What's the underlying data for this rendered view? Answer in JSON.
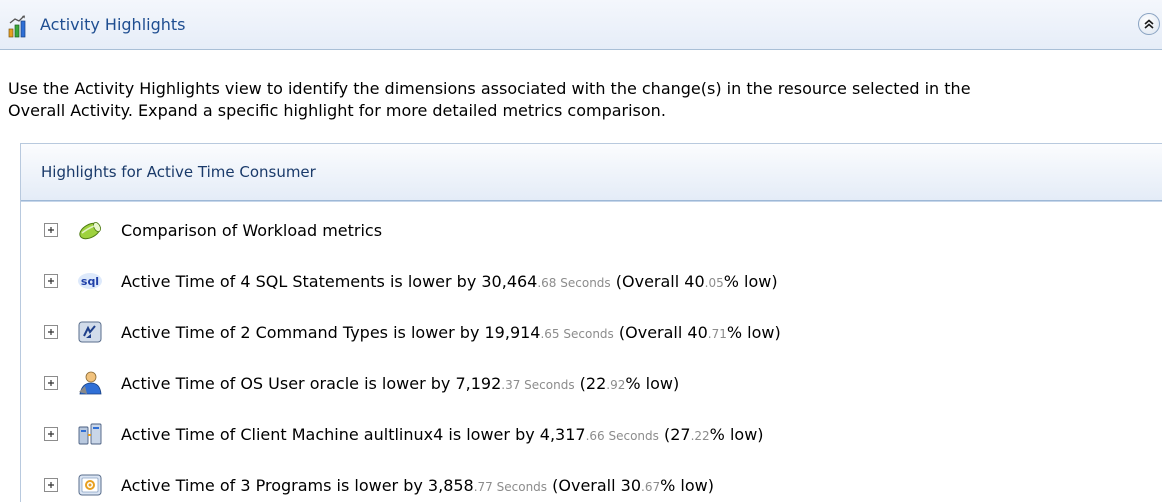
{
  "header": {
    "title": "Activity Highlights",
    "icon": "activity-chart-icon",
    "collapse_icon": "double-chevron-up-icon"
  },
  "intro": {
    "line1": "Use the Activity Highlights view to identify the dimensions associated with the change(s) in the resource selected in the",
    "line2": "Overall Activity. Expand a specific highlight for more detailed metrics comparison."
  },
  "highlights": {
    "title": "Highlights for Active Time Consumer",
    "rows": [
      {
        "icon": "workload-capsule-icon",
        "text": "Comparison of Workload metrics"
      },
      {
        "icon": "sql-icon",
        "prefix": "Active Time of 4 SQL Statements is lower by 30,464",
        "decimals": ".68 Seconds",
        "mid": " (Overall 40",
        "pct_decimals": ".05",
        "suffix": "% low)"
      },
      {
        "icon": "command-types-icon",
        "prefix": "Active Time of 2 Command Types is lower by 19,914",
        "decimals": ".65 Seconds",
        "mid": " (Overall 40",
        "pct_decimals": ".71",
        "suffix": "% low)"
      },
      {
        "icon": "os-user-icon",
        "prefix": "Active Time of OS User oracle is lower by 7,192",
        "decimals": ".37 Seconds",
        "mid": " (22",
        "pct_decimals": ".92",
        "suffix": "% low)"
      },
      {
        "icon": "client-machine-icon",
        "prefix": "Active Time of Client Machine aultlinux4 is lower by 4,317",
        "decimals": ".66 Seconds",
        "mid": " (27",
        "pct_decimals": ".22",
        "suffix": "% low)"
      },
      {
        "icon": "programs-icon",
        "prefix": "Active Time of 3 Programs is lower by 3,858",
        "decimals": ".77 Seconds",
        "mid": " (Overall 30",
        "pct_decimals": ".67",
        "suffix": "% low)"
      }
    ]
  }
}
